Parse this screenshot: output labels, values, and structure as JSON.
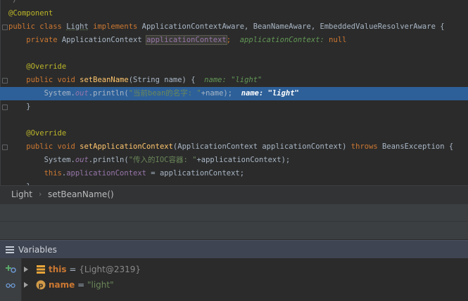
{
  "editor": {
    "lines": [
      {
        "id": "l0",
        "parts": [
          {
            "t": "*/",
            "c": "comment"
          }
        ]
      },
      {
        "id": "l1",
        "parts": [
          {
            "t": "@Component",
            "c": "ann"
          }
        ]
      },
      {
        "id": "l2",
        "parts": [
          {
            "t": "public class ",
            "c": "kw"
          },
          {
            "t": "Light",
            "c": "undl"
          },
          {
            "t": " ",
            "c": ""
          },
          {
            "t": "implements",
            "c": "kw"
          },
          {
            "t": " ApplicationContextAware, BeanNameAware, EmbeddedValueResolverAware {",
            "c": ""
          }
        ]
      },
      {
        "id": "l3",
        "parts": [
          {
            "t": "    private ",
            "c": "kw"
          },
          {
            "t": "ApplicationContext ",
            "c": ""
          },
          {
            "t": "applicationContext",
            "c": "boxed"
          },
          {
            "t": ";",
            "c": "kw"
          },
          {
            "t": "  applicationContext: ",
            "c": "hint"
          },
          {
            "t": "null",
            "c": "kw"
          }
        ]
      },
      {
        "id": "l4",
        "parts": []
      },
      {
        "id": "l5",
        "parts": [
          {
            "t": "    @Override",
            "c": "ann"
          }
        ]
      },
      {
        "id": "l6",
        "parts": [
          {
            "t": "    public void ",
            "c": "kw"
          },
          {
            "t": "setBeanName",
            "c": "fn"
          },
          {
            "t": "(String name) {",
            "c": ""
          },
          {
            "t": "  name: \"light\"",
            "c": "hint"
          }
        ]
      },
      {
        "id": "l7",
        "exec": true,
        "parts": [
          {
            "t": "        System.",
            "c": ""
          },
          {
            "t": "out",
            "c": "italic-field"
          },
          {
            "t": ".println(",
            "c": ""
          },
          {
            "t": "\"当前bean的名字: \"",
            "c": "str"
          },
          {
            "t": "+name);",
            "c": ""
          },
          {
            "t": "  name: ",
            "c": "hint-hl"
          },
          {
            "t": "\"light\"",
            "c": "hint-hl"
          }
        ]
      },
      {
        "id": "l8",
        "parts": [
          {
            "t": "    }",
            "c": ""
          }
        ]
      },
      {
        "id": "l9",
        "parts": []
      },
      {
        "id": "l10",
        "parts": [
          {
            "t": "    @Override",
            "c": "ann"
          }
        ]
      },
      {
        "id": "l11",
        "parts": [
          {
            "t": "    public void ",
            "c": "kw"
          },
          {
            "t": "setApplicationContext",
            "c": "fn"
          },
          {
            "t": "(ApplicationContext applicationContext) ",
            "c": ""
          },
          {
            "t": "throws",
            "c": "kw"
          },
          {
            "t": " BeansException {",
            "c": ""
          }
        ]
      },
      {
        "id": "l12",
        "parts": [
          {
            "t": "        System.",
            "c": ""
          },
          {
            "t": "out",
            "c": "italic-field"
          },
          {
            "t": ".println(",
            "c": ""
          },
          {
            "t": "\"传入的IOC容器: \"",
            "c": "str"
          },
          {
            "t": "+applicationContext);",
            "c": ""
          }
        ]
      },
      {
        "id": "l13",
        "parts": [
          {
            "t": "        this",
            "c": "kw"
          },
          {
            "t": ".",
            "c": ""
          },
          {
            "t": "applicationContext",
            "c": "field"
          },
          {
            "t": " = applicationContext;",
            "c": ""
          }
        ]
      },
      {
        "id": "l14",
        "parts": [
          {
            "t": "    }",
            "c": ""
          }
        ]
      }
    ]
  },
  "breadcrumb": {
    "items": [
      "Light",
      "setBeanName()"
    ],
    "separator": "›"
  },
  "variables_panel": {
    "title": "Variables",
    "rows": [
      {
        "name": "this",
        "eq": " = ",
        "value": "{Light@2319}",
        "icon": "object-fields-icon",
        "value_type": "obj"
      },
      {
        "name": "name",
        "eq": " = ",
        "value": "\"light\"",
        "icon": "parameter-p-icon",
        "icon_letter": "p",
        "value_type": "str"
      }
    ]
  },
  "colors": {
    "editor_bg": "#2b2b2b",
    "exec_line": "#2d6099",
    "keyword": "#cc7832",
    "annotation": "#bbb529",
    "method": "#ffc66d",
    "string": "#6a8759"
  }
}
